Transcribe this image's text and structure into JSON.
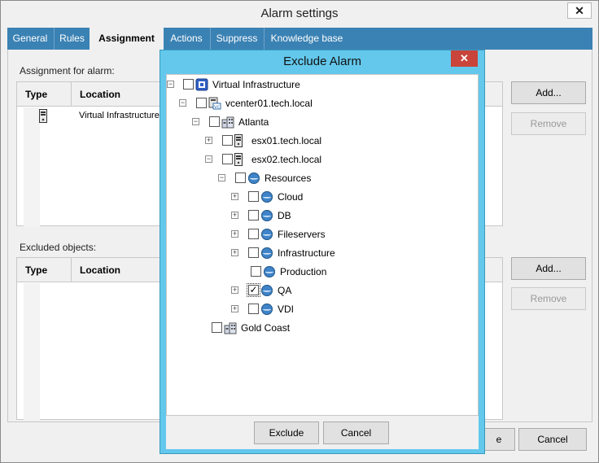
{
  "window": {
    "title": "Alarm settings",
    "close_glyph": "✕"
  },
  "tabs": [
    {
      "label": "General"
    },
    {
      "label": "Rules"
    },
    {
      "label": "Assignment"
    },
    {
      "label": "Actions"
    },
    {
      "label": "Suppress"
    },
    {
      "label": "Knowledge base"
    }
  ],
  "assignment": {
    "label": "Assignment for alarm:",
    "columns": [
      "Type",
      "Location"
    ],
    "rows": [
      {
        "type_icon": "host-icon",
        "location": "Virtual Infrastructure"
      }
    ],
    "add_label": "Add...",
    "remove_label": "Remove"
  },
  "excluded": {
    "label": "Excluded objects:",
    "columns": [
      "Type",
      "Location"
    ],
    "add_label": "Add...",
    "remove_label": "Remove"
  },
  "bottom": {
    "ok_partial": "e",
    "cancel_label": "Cancel"
  },
  "dialog": {
    "title": "Exclude Alarm",
    "close_glyph": "✕",
    "tree": [
      {
        "label": "Virtual Infrastructure",
        "icon": "virtual-infrastructure-icon",
        "expander": "⊟",
        "checked": false
      },
      {
        "label": "vcenter01.tech.local",
        "icon": "vcenter-icon",
        "expander": "⊟",
        "checked": false
      },
      {
        "label": "Atlanta",
        "icon": "datacenter-icon",
        "expander": "⊟",
        "checked": false
      },
      {
        "label": "esx01.tech.local",
        "icon": "host-icon",
        "expander": "⊞",
        "checked": false
      },
      {
        "label": "esx02.tech.local",
        "icon": "host-icon",
        "expander": "⊟",
        "checked": false
      },
      {
        "label": "Resources",
        "icon": "resource-pool-icon",
        "expander": "⊟",
        "checked": false
      },
      {
        "label": "Cloud",
        "icon": "resource-pool-icon",
        "expander": "⊞",
        "checked": false
      },
      {
        "label": "DB",
        "icon": "resource-pool-icon",
        "expander": "⊞",
        "checked": false
      },
      {
        "label": "Fileservers",
        "icon": "resource-pool-icon",
        "expander": "⊞",
        "checked": false
      },
      {
        "label": "Infrastructure",
        "icon": "resource-pool-icon",
        "expander": "⊞",
        "checked": false
      },
      {
        "label": "Production",
        "icon": "resource-pool-icon",
        "expander": "",
        "checked": false
      },
      {
        "label": "QA",
        "icon": "resource-pool-icon",
        "expander": "⊞",
        "checked": true
      },
      {
        "label": "VDI",
        "icon": "resource-pool-icon",
        "expander": "⊞",
        "checked": false
      },
      {
        "label": "Gold Coast",
        "icon": "datacenter-icon",
        "expander": "",
        "checked": false
      }
    ],
    "exclude_label": "Exclude",
    "cancel_label": "Cancel"
  },
  "colors": {
    "tabbar": "#3b82b4",
    "dialog_frame": "#63c8ec",
    "dialog_close": "#c9443a"
  }
}
